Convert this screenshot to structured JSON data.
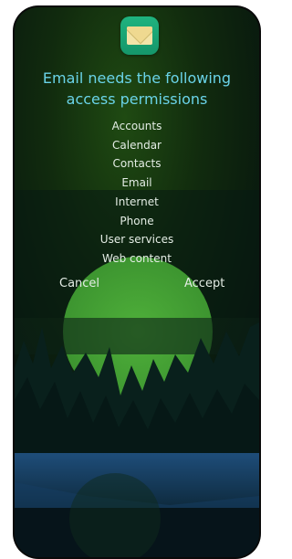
{
  "dialog": {
    "app_icon": "envelope-icon",
    "title": "Email needs the following access permissions",
    "permissions": [
      "Accounts",
      "Calendar",
      "Contacts",
      "Email",
      "Internet",
      "Phone",
      "User services",
      "Web content"
    ],
    "cancel_label": "Cancel",
    "accept_label": "Accept"
  },
  "colors": {
    "title": "#6ad3e8",
    "text": "#e4ede5",
    "icon": "#1fb37f"
  }
}
